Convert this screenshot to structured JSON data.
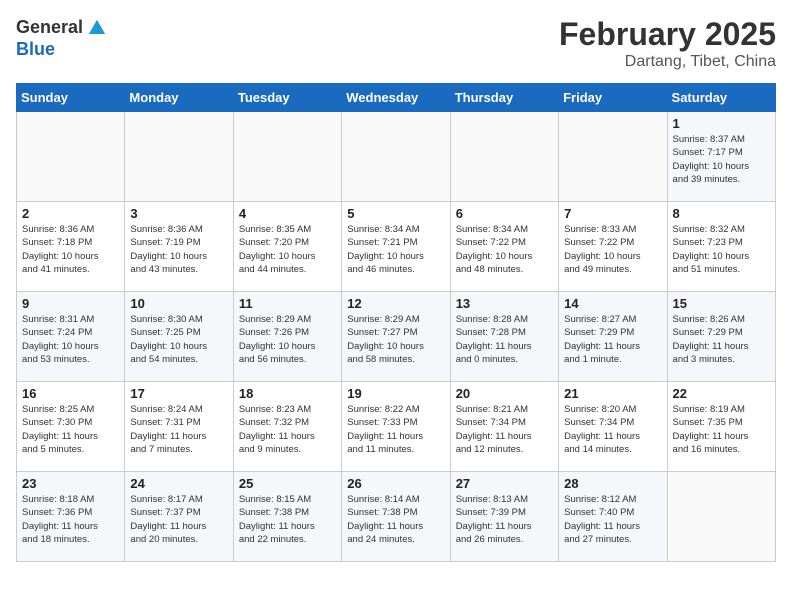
{
  "logo": {
    "text_general": "General",
    "text_blue": "Blue"
  },
  "calendar": {
    "title": "February 2025",
    "subtitle": "Dartang, Tibet, China"
  },
  "weekdays": [
    "Sunday",
    "Monday",
    "Tuesday",
    "Wednesday",
    "Thursday",
    "Friday",
    "Saturday"
  ],
  "weeks": [
    [
      {
        "day": "",
        "info": ""
      },
      {
        "day": "",
        "info": ""
      },
      {
        "day": "",
        "info": ""
      },
      {
        "day": "",
        "info": ""
      },
      {
        "day": "",
        "info": ""
      },
      {
        "day": "",
        "info": ""
      },
      {
        "day": "1",
        "info": "Sunrise: 8:37 AM\nSunset: 7:17 PM\nDaylight: 10 hours\nand 39 minutes."
      }
    ],
    [
      {
        "day": "2",
        "info": "Sunrise: 8:36 AM\nSunset: 7:18 PM\nDaylight: 10 hours\nand 41 minutes."
      },
      {
        "day": "3",
        "info": "Sunrise: 8:36 AM\nSunset: 7:19 PM\nDaylight: 10 hours\nand 43 minutes."
      },
      {
        "day": "4",
        "info": "Sunrise: 8:35 AM\nSunset: 7:20 PM\nDaylight: 10 hours\nand 44 minutes."
      },
      {
        "day": "5",
        "info": "Sunrise: 8:34 AM\nSunset: 7:21 PM\nDaylight: 10 hours\nand 46 minutes."
      },
      {
        "day": "6",
        "info": "Sunrise: 8:34 AM\nSunset: 7:22 PM\nDaylight: 10 hours\nand 48 minutes."
      },
      {
        "day": "7",
        "info": "Sunrise: 8:33 AM\nSunset: 7:22 PM\nDaylight: 10 hours\nand 49 minutes."
      },
      {
        "day": "8",
        "info": "Sunrise: 8:32 AM\nSunset: 7:23 PM\nDaylight: 10 hours\nand 51 minutes."
      }
    ],
    [
      {
        "day": "9",
        "info": "Sunrise: 8:31 AM\nSunset: 7:24 PM\nDaylight: 10 hours\nand 53 minutes."
      },
      {
        "day": "10",
        "info": "Sunrise: 8:30 AM\nSunset: 7:25 PM\nDaylight: 10 hours\nand 54 minutes."
      },
      {
        "day": "11",
        "info": "Sunrise: 8:29 AM\nSunset: 7:26 PM\nDaylight: 10 hours\nand 56 minutes."
      },
      {
        "day": "12",
        "info": "Sunrise: 8:29 AM\nSunset: 7:27 PM\nDaylight: 10 hours\nand 58 minutes."
      },
      {
        "day": "13",
        "info": "Sunrise: 8:28 AM\nSunset: 7:28 PM\nDaylight: 11 hours\nand 0 minutes."
      },
      {
        "day": "14",
        "info": "Sunrise: 8:27 AM\nSunset: 7:29 PM\nDaylight: 11 hours\nand 1 minute."
      },
      {
        "day": "15",
        "info": "Sunrise: 8:26 AM\nSunset: 7:29 PM\nDaylight: 11 hours\nand 3 minutes."
      }
    ],
    [
      {
        "day": "16",
        "info": "Sunrise: 8:25 AM\nSunset: 7:30 PM\nDaylight: 11 hours\nand 5 minutes."
      },
      {
        "day": "17",
        "info": "Sunrise: 8:24 AM\nSunset: 7:31 PM\nDaylight: 11 hours\nand 7 minutes."
      },
      {
        "day": "18",
        "info": "Sunrise: 8:23 AM\nSunset: 7:32 PM\nDaylight: 11 hours\nand 9 minutes."
      },
      {
        "day": "19",
        "info": "Sunrise: 8:22 AM\nSunset: 7:33 PM\nDaylight: 11 hours\nand 11 minutes."
      },
      {
        "day": "20",
        "info": "Sunrise: 8:21 AM\nSunset: 7:34 PM\nDaylight: 11 hours\nand 12 minutes."
      },
      {
        "day": "21",
        "info": "Sunrise: 8:20 AM\nSunset: 7:34 PM\nDaylight: 11 hours\nand 14 minutes."
      },
      {
        "day": "22",
        "info": "Sunrise: 8:19 AM\nSunset: 7:35 PM\nDaylight: 11 hours\nand 16 minutes."
      }
    ],
    [
      {
        "day": "23",
        "info": "Sunrise: 8:18 AM\nSunset: 7:36 PM\nDaylight: 11 hours\nand 18 minutes."
      },
      {
        "day": "24",
        "info": "Sunrise: 8:17 AM\nSunset: 7:37 PM\nDaylight: 11 hours\nand 20 minutes."
      },
      {
        "day": "25",
        "info": "Sunrise: 8:15 AM\nSunset: 7:38 PM\nDaylight: 11 hours\nand 22 minutes."
      },
      {
        "day": "26",
        "info": "Sunrise: 8:14 AM\nSunset: 7:38 PM\nDaylight: 11 hours\nand 24 minutes."
      },
      {
        "day": "27",
        "info": "Sunrise: 8:13 AM\nSunset: 7:39 PM\nDaylight: 11 hours\nand 26 minutes."
      },
      {
        "day": "28",
        "info": "Sunrise: 8:12 AM\nSunset: 7:40 PM\nDaylight: 11 hours\nand 27 minutes."
      },
      {
        "day": "",
        "info": ""
      }
    ]
  ]
}
